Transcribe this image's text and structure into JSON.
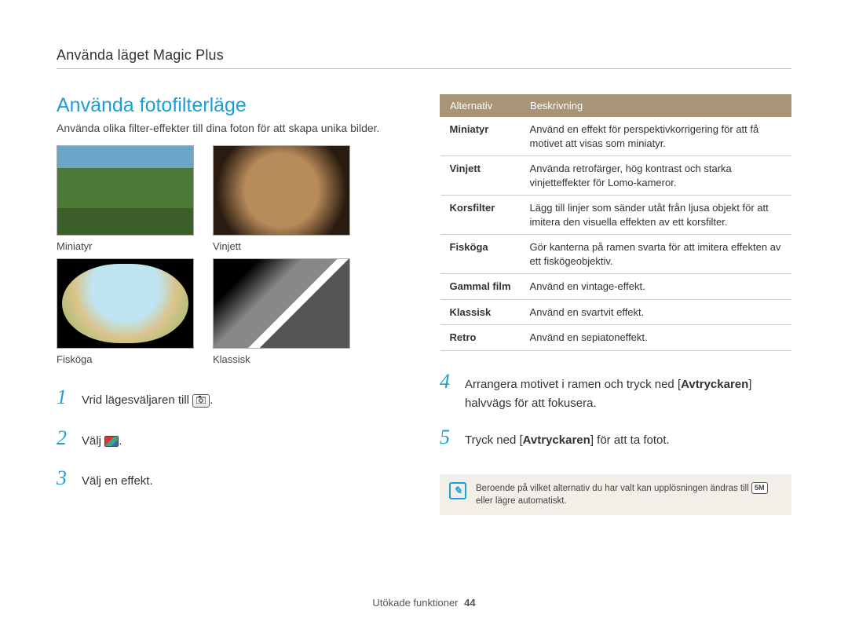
{
  "breadcrumb": "Använda läget Magic Plus",
  "section_title": "Använda fotofilterläge",
  "intro": "Använda olika filter-effekter till dina foton för att skapa unika bilder.",
  "thumbs": {
    "miniatyr": "Miniatyr",
    "vinjett": "Vinjett",
    "fiskoga": "Fisköga",
    "klassisk": "Klassisk"
  },
  "steps": {
    "s1_pre": "Vrid lägesväljaren till ",
    "s1_post": ".",
    "s2_pre": "Välj ",
    "s2_post": ".",
    "s3": "Välj en effekt.",
    "s4_pre": "Arrangera motivet i ramen och tryck ned [",
    "s4_bold": "Avtryckaren",
    "s4_post": "] halvvägs för att fokusera.",
    "s5_pre": "Tryck ned [",
    "s5_bold": "Avtryckaren",
    "s5_post": "] för att ta fotot."
  },
  "table": {
    "head_alt": "Alternativ",
    "head_desc": "Beskrivning",
    "rows": [
      {
        "name": "Miniatyr",
        "desc": "Använd en effekt för perspektivkorrigering för att få motivet att visas som miniatyr."
      },
      {
        "name": "Vinjett",
        "desc": "Använda retrofärger, hög kontrast och starka vinjetteffekter för Lomo-kameror."
      },
      {
        "name": "Korsfilter",
        "desc": "Lägg till linjer som sänder utåt från ljusa objekt för att imitera den visuella effekten av ett korsfilter."
      },
      {
        "name": "Fisköga",
        "desc": "Gör kanterna på ramen svarta för att imitera effekten av ett fiskögeobjektiv."
      },
      {
        "name": "Gammal film",
        "desc": "Använd en vintage-effekt."
      },
      {
        "name": "Klassisk",
        "desc": "Använd en svartvit effekt."
      },
      {
        "name": "Retro",
        "desc": "Använd en sepiatoneffekt."
      }
    ]
  },
  "note": {
    "text_pre": "Beroende på vilket alternativ du har valt kan upplösningen ändras till ",
    "badge": "5M",
    "text_post": " eller lägre automatiskt."
  },
  "footer": {
    "label": "Utökade funktioner",
    "page": "44"
  },
  "icons": {
    "camera": "camera-icon",
    "photo_mode": "photo-mode-icon",
    "note": "note-icon"
  }
}
